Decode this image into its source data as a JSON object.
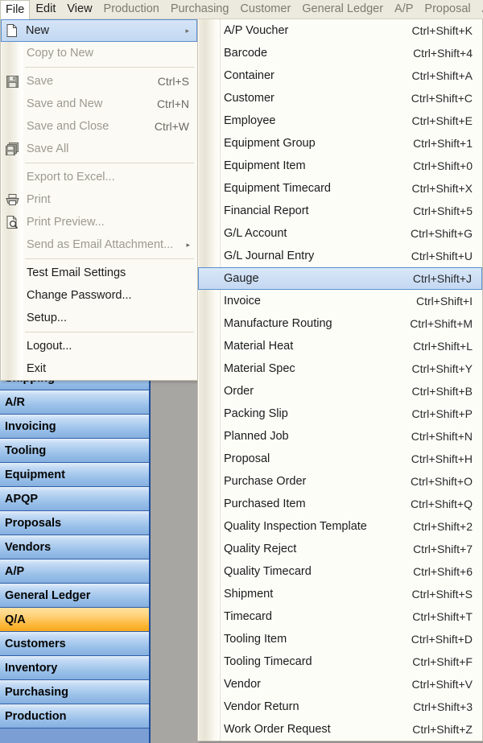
{
  "window": {
    "bg_color": "#a7a6a3",
    "accent_blue": "#1f4e9c",
    "accent_orange": "#f7a81b",
    "menu_bg": "#eceade"
  },
  "menubar": {
    "items": [
      {
        "label": "File",
        "state": "active",
        "icon": ""
      },
      {
        "label": "Edit",
        "state": "enabled",
        "icon": ""
      },
      {
        "label": "View",
        "state": "enabled",
        "icon": ""
      },
      {
        "label": "Production",
        "state": "disabled",
        "icon": ""
      },
      {
        "label": "Purchasing",
        "state": "disabled",
        "icon": ""
      },
      {
        "label": "Customer",
        "state": "disabled",
        "icon": ""
      },
      {
        "label": "General Ledger",
        "state": "disabled",
        "icon": ""
      },
      {
        "label": "A/P",
        "state": "disabled",
        "icon": ""
      },
      {
        "label": "Proposal",
        "state": "disabled",
        "icon": ""
      },
      {
        "label": "AP",
        "state": "disabled",
        "icon": ""
      }
    ]
  },
  "file_menu": {
    "rows": [
      {
        "kind": "item",
        "label": "New",
        "accel": "",
        "icon": "new-document-icon",
        "state": "enabled",
        "submenu": true,
        "highlight": true,
        "arrow": "▸"
      },
      {
        "kind": "item",
        "label": "Copy to New",
        "accel": "",
        "icon": "",
        "state": "disabled",
        "submenu": false,
        "highlight": false,
        "arrow": ""
      },
      {
        "kind": "sep"
      },
      {
        "kind": "item",
        "label": "Save",
        "accel": "Ctrl+S",
        "icon": "save-floppy-icon",
        "state": "disabled",
        "submenu": false,
        "highlight": false,
        "arrow": ""
      },
      {
        "kind": "item",
        "label": "Save and New",
        "accel": "Ctrl+N",
        "icon": "",
        "state": "disabled",
        "submenu": false,
        "highlight": false,
        "arrow": ""
      },
      {
        "kind": "item",
        "label": "Save and Close",
        "accel": "Ctrl+W",
        "icon": "",
        "state": "disabled",
        "submenu": false,
        "highlight": false,
        "arrow": ""
      },
      {
        "kind": "item",
        "label": "Save All",
        "accel": "",
        "icon": "save-all-icon",
        "state": "disabled",
        "submenu": false,
        "highlight": false,
        "arrow": ""
      },
      {
        "kind": "sep"
      },
      {
        "kind": "item",
        "label": "Export to Excel...",
        "accel": "",
        "icon": "",
        "state": "disabled",
        "submenu": false,
        "highlight": false,
        "arrow": ""
      },
      {
        "kind": "item",
        "label": "Print",
        "accel": "",
        "icon": "printer-icon",
        "state": "disabled",
        "submenu": false,
        "highlight": false,
        "arrow": ""
      },
      {
        "kind": "item",
        "label": "Print Preview...",
        "accel": "",
        "icon": "print-preview-icon",
        "state": "disabled",
        "submenu": false,
        "highlight": false,
        "arrow": ""
      },
      {
        "kind": "item",
        "label": "Send as Email Attachment...",
        "accel": "",
        "icon": "",
        "state": "disabled",
        "submenu": true,
        "highlight": false,
        "arrow": "▸"
      },
      {
        "kind": "sep"
      },
      {
        "kind": "item",
        "label": "Test Email Settings",
        "accel": "",
        "icon": "",
        "state": "enabled",
        "submenu": false,
        "highlight": false,
        "arrow": ""
      },
      {
        "kind": "item",
        "label": "Change Password...",
        "accel": "",
        "icon": "",
        "state": "enabled",
        "submenu": false,
        "highlight": false,
        "arrow": ""
      },
      {
        "kind": "item",
        "label": "Setup...",
        "accel": "",
        "icon": "",
        "state": "enabled",
        "submenu": false,
        "highlight": false,
        "arrow": ""
      },
      {
        "kind": "sep"
      },
      {
        "kind": "item",
        "label": "Logout...",
        "accel": "",
        "icon": "",
        "state": "enabled",
        "submenu": false,
        "highlight": false,
        "arrow": ""
      },
      {
        "kind": "item",
        "label": "Exit",
        "accel": "",
        "icon": "",
        "state": "enabled",
        "submenu": false,
        "highlight": false,
        "arrow": ""
      }
    ]
  },
  "new_submenu": {
    "selected": "Gauge",
    "rows": [
      {
        "label": "A/P Voucher",
        "accel": "Ctrl+Shift+K",
        "highlight": false
      },
      {
        "label": "Barcode",
        "accel": "Ctrl+Shift+4",
        "highlight": false
      },
      {
        "label": "Container",
        "accel": "Ctrl+Shift+A",
        "highlight": false
      },
      {
        "label": "Customer",
        "accel": "Ctrl+Shift+C",
        "highlight": false
      },
      {
        "label": "Employee",
        "accel": "Ctrl+Shift+E",
        "highlight": false
      },
      {
        "label": "Equipment Group",
        "accel": "Ctrl+Shift+1",
        "highlight": false
      },
      {
        "label": "Equipment Item",
        "accel": "Ctrl+Shift+0",
        "highlight": false
      },
      {
        "label": "Equipment Timecard",
        "accel": "Ctrl+Shift+X",
        "highlight": false
      },
      {
        "label": "Financial Report",
        "accel": "Ctrl+Shift+5",
        "highlight": false
      },
      {
        "label": "G/L Account",
        "accel": "Ctrl+Shift+G",
        "highlight": false
      },
      {
        "label": "G/L Journal Entry",
        "accel": "Ctrl+Shift+U",
        "highlight": false
      },
      {
        "label": "Gauge",
        "accel": "Ctrl+Shift+J",
        "highlight": true
      },
      {
        "label": "Invoice",
        "accel": "Ctrl+Shift+I",
        "highlight": false
      },
      {
        "label": "Manufacture Routing",
        "accel": "Ctrl+Shift+M",
        "highlight": false
      },
      {
        "label": "Material Heat",
        "accel": "Ctrl+Shift+L",
        "highlight": false
      },
      {
        "label": "Material Spec",
        "accel": "Ctrl+Shift+Y",
        "highlight": false
      },
      {
        "label": "Order",
        "accel": "Ctrl+Shift+B",
        "highlight": false
      },
      {
        "label": "Packing Slip",
        "accel": "Ctrl+Shift+P",
        "highlight": false
      },
      {
        "label": "Planned Job",
        "accel": "Ctrl+Shift+N",
        "highlight": false
      },
      {
        "label": "Proposal",
        "accel": "Ctrl+Shift+H",
        "highlight": false
      },
      {
        "label": "Purchase Order",
        "accel": "Ctrl+Shift+O",
        "highlight": false
      },
      {
        "label": "Purchased Item",
        "accel": "Ctrl+Shift+Q",
        "highlight": false
      },
      {
        "label": "Quality Inspection Template",
        "accel": "Ctrl+Shift+2",
        "highlight": false
      },
      {
        "label": "Quality Reject",
        "accel": "Ctrl+Shift+7",
        "highlight": false
      },
      {
        "label": "Quality Timecard",
        "accel": "Ctrl+Shift+6",
        "highlight": false
      },
      {
        "label": "Shipment",
        "accel": "Ctrl+Shift+S",
        "highlight": false
      },
      {
        "label": "Timecard",
        "accel": "Ctrl+Shift+T",
        "highlight": false
      },
      {
        "label": "Tooling Item",
        "accel": "Ctrl+Shift+D",
        "highlight": false
      },
      {
        "label": "Tooling Timecard",
        "accel": "Ctrl+Shift+F",
        "highlight": false
      },
      {
        "label": "Vendor",
        "accel": "Ctrl+Shift+V",
        "highlight": false
      },
      {
        "label": "Vendor Return",
        "accel": "Ctrl+Shift+3",
        "highlight": false
      },
      {
        "label": "Work Order Request",
        "accel": "Ctrl+Shift+Z",
        "highlight": false
      }
    ]
  },
  "nav_panel": {
    "selected": "Q/A",
    "items": [
      {
        "label": "Shipping",
        "selected": false
      },
      {
        "label": "A/R",
        "selected": false
      },
      {
        "label": "Invoicing",
        "selected": false
      },
      {
        "label": "Tooling",
        "selected": false
      },
      {
        "label": "Equipment",
        "selected": false
      },
      {
        "label": "APQP",
        "selected": false
      },
      {
        "label": "Proposals",
        "selected": false
      },
      {
        "label": "Vendors",
        "selected": false
      },
      {
        "label": "A/P",
        "selected": false
      },
      {
        "label": "General Ledger",
        "selected": false
      },
      {
        "label": "Q/A",
        "selected": true
      },
      {
        "label": "Customers",
        "selected": false
      },
      {
        "label": "Inventory",
        "selected": false
      },
      {
        "label": "Purchasing",
        "selected": false
      },
      {
        "label": "Production",
        "selected": false
      }
    ]
  }
}
